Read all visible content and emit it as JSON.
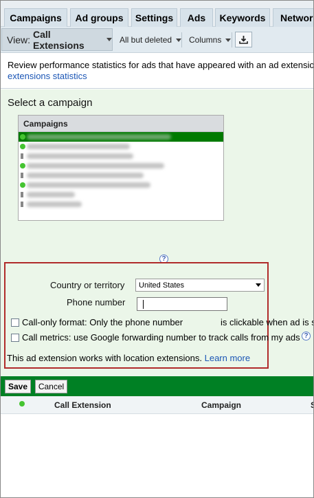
{
  "tabs": [
    "Campaigns",
    "Ad groups",
    "Settings",
    "Ads",
    "Keywords",
    "Network"
  ],
  "toolbar": {
    "view_prefix": "View:",
    "view_value": "Call Extensions",
    "filter": "All but deleted",
    "columns": "Columns"
  },
  "description": {
    "text": "Review performance statistics for ads that have appeared with an ad extension",
    "link": "extensions statistics"
  },
  "campaign_select": {
    "title": "Select a campaign",
    "header": "Campaigns"
  },
  "form": {
    "country_label": "Country or territory",
    "country_value": "United States",
    "phone_label": "Phone number",
    "phone_value": "",
    "call_only_text_a": "Call-only format: Only the phone number",
    "call_only_text_b": "is clickable when ad is s",
    "call_metrics_text": "Call metrics: use Google forwarding number to track calls from my ads",
    "note_text": "This ad extension works with location extensions.",
    "note_link": "Learn more"
  },
  "actions": {
    "save": "Save",
    "cancel": "Cancel"
  },
  "table": {
    "columns": [
      "Call Extension",
      "Campaign",
      "S"
    ]
  },
  "colors": {
    "green_bar": "#008024",
    "panel_bg": "#ebf6e9",
    "highlight_border": "#b02a2a",
    "link": "#1a55b5"
  }
}
